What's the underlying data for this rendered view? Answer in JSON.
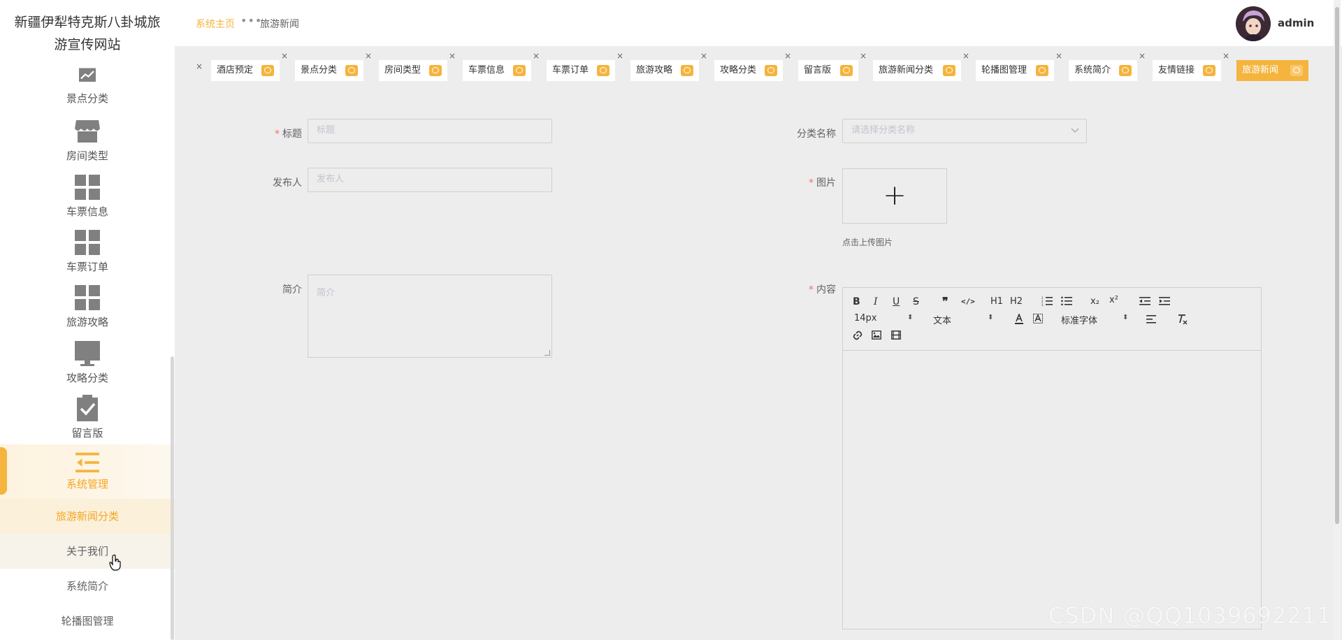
{
  "sidebar": {
    "site_title": "新疆伊犁特克斯八卦城旅游宣传网站",
    "menu": [
      {
        "label": "景点分类",
        "icon": "chart-icon"
      },
      {
        "label": "房间类型",
        "icon": "shop-icon"
      },
      {
        "label": "车票信息",
        "icon": "grid-icon"
      },
      {
        "label": "车票订单",
        "icon": "grid-icon"
      },
      {
        "label": "旅游攻略",
        "icon": "grid-icon"
      },
      {
        "label": "攻略分类",
        "icon": "monitor-icon"
      },
      {
        "label": "留言版",
        "icon": "clipboard-check-icon"
      },
      {
        "label": "系统管理",
        "icon": "menu-collapse-icon"
      }
    ],
    "submenu": [
      {
        "label": "旅游新闻分类"
      },
      {
        "label": "关于我们"
      },
      {
        "label": "系统简介"
      },
      {
        "label": "轮播图管理"
      }
    ]
  },
  "header": {
    "breadcrumb_home": "系统主页",
    "breadcrumb_sep": "•••",
    "breadcrumb_current": "旅游新闻",
    "username": "admin"
  },
  "tags": [
    {
      "label": "酒店预定"
    },
    {
      "label": "景点分类"
    },
    {
      "label": "房间类型"
    },
    {
      "label": "车票信息"
    },
    {
      "label": "车票订单"
    },
    {
      "label": "旅游攻略"
    },
    {
      "label": "攻略分类"
    },
    {
      "label": "留言版"
    },
    {
      "label": "旅游新闻分类"
    },
    {
      "label": "轮播图管理"
    },
    {
      "label": "系统简介"
    },
    {
      "label": "友情链接"
    },
    {
      "label": "旅游新闻"
    }
  ],
  "form": {
    "title_label": "标题",
    "title_placeholder": "标题",
    "category_label": "分类名称",
    "category_placeholder": "请选择分类名称",
    "publisher_label": "发布人",
    "publisher_placeholder": "发布人",
    "image_label": "图片",
    "upload_plus": "+",
    "upload_tip": "点击上传图片",
    "intro_label": "简介",
    "intro_placeholder": "简介",
    "content_label": "内容",
    "required_mark": "*"
  },
  "editor": {
    "bold": "B",
    "italic": "I",
    "underline": "U",
    "strike": "S",
    "quote": "❞",
    "code": "</>",
    "h1": "H1",
    "h2": "H2",
    "sub": "x₂",
    "sup": "x²",
    "font_size": "14px",
    "block_type": "文本",
    "font_family": "标准字体"
  },
  "watermark": "CSDN @QQ1039692211",
  "colors": {
    "accent": "#f5b43d",
    "required": "#f56c6c"
  }
}
